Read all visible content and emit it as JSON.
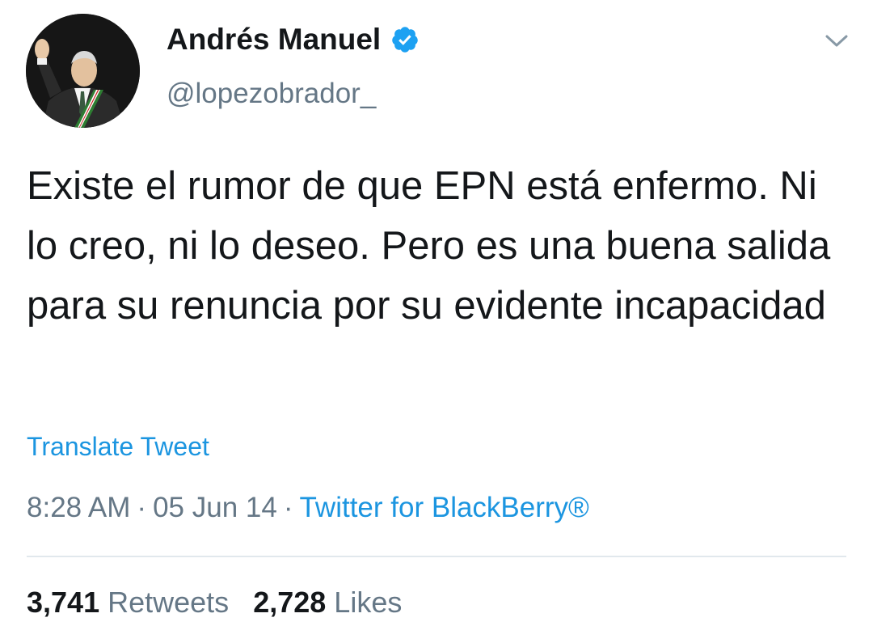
{
  "tweet": {
    "author": {
      "display_name": "Andrés Manuel",
      "handle": "@lopezobrador_",
      "verified": true,
      "avatar_icon": "profile-photo-icon",
      "verified_icon": "verified-badge-icon"
    },
    "menu_icon": "chevron-down-icon",
    "text": "Existe el rumor de que EPN está enfermo. Ni lo creo, ni lo deseo. Pero es una buena salida para su renuncia por su evidente incapacidad",
    "translate_label": "Translate Tweet",
    "time": "8:28 AM",
    "date": "05 Jun 14",
    "separator": "·",
    "source": "Twitter for BlackBerry®",
    "stats": {
      "retweets_count": "3,741",
      "retweets_label": "Retweets",
      "likes_count": "2,728",
      "likes_label": "Likes"
    }
  },
  "colors": {
    "text_primary": "#14171a",
    "text_secondary": "#657786",
    "link": "#1b95e0",
    "verified": "#1da1f2",
    "divider": "#e1e8ed"
  }
}
